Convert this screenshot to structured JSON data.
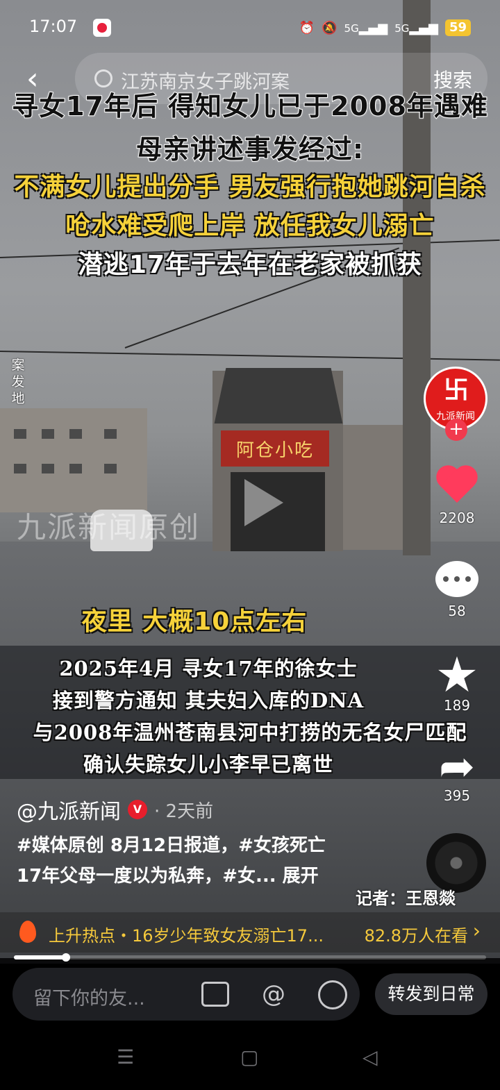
{
  "status_bar": {
    "time": "17:07",
    "battery": "59",
    "icons": [
      "alarm-icon",
      "mute-icon",
      "signal-5g-icon",
      "signal-5g-icon"
    ],
    "net1": "5G",
    "net2": "5G"
  },
  "search": {
    "query": "江苏南京女子跳河案",
    "button": "搜索"
  },
  "captions": {
    "line1": "寻女17年后 得知女儿已于2008年遇难",
    "line2": "母亲讲述事发经过:",
    "line3": "不满女儿提出分手 男友强行抱她跳河自杀",
    "line4": "呛水难受爬上岸 放任我女儿溺亡",
    "line5": "潜逃17年于去年在老家被抓获",
    "side_label": "案发地",
    "shop_sign": "阿仓小吃",
    "watermark": "九派新闻原创",
    "night": "夜里 大概10点左右",
    "body1": "2025年4月 寻女17年的徐女士",
    "body2": "接到警方通知 其夫妇入库的DNA",
    "body3": "与2008年温州苍南县河中打捞的无名女尸匹配",
    "body4": "确认失踪女儿小李早已离世"
  },
  "rail": {
    "avatar_name": "九派新闻",
    "likes": "2208",
    "comments": "58",
    "favorites": "189",
    "shares": "395"
  },
  "post": {
    "author": "@九派新闻",
    "time_ago": "· 2天前",
    "desc_line1": "#媒体原创 8月12日报道，#女孩死亡",
    "desc_line2": "17年父母一度以为私奔，#女...  展开",
    "reporter": "记者：王恩燚"
  },
  "hot": {
    "label": "上升热点・16岁少年致女友溺亡17...",
    "watching": "82.8万人在看"
  },
  "progress": 0.11,
  "bottom": {
    "comment_placeholder": "留下你的友...",
    "repost": "转发到日常"
  },
  "colors": {
    "accent_yellow": "#f6d23a",
    "like_red": "#ff3b5c",
    "brand_red": "#e01c1c"
  }
}
